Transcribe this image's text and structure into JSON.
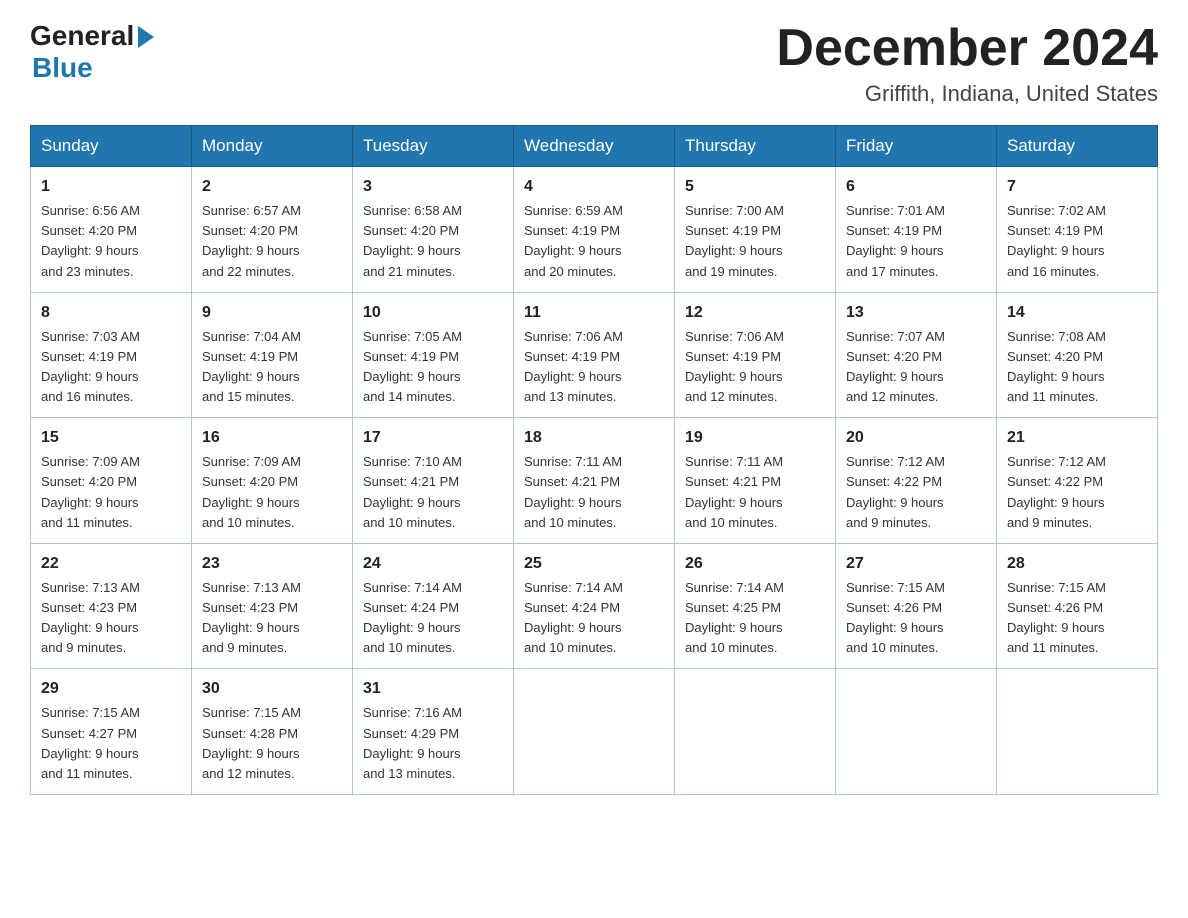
{
  "logo": {
    "line1": "General",
    "arrow": "▶",
    "line2": "Blue"
  },
  "header": {
    "month_title": "December 2024",
    "location": "Griffith, Indiana, United States"
  },
  "weekdays": [
    "Sunday",
    "Monday",
    "Tuesday",
    "Wednesday",
    "Thursday",
    "Friday",
    "Saturday"
  ],
  "weeks": [
    [
      {
        "day": "1",
        "sunrise": "6:56 AM",
        "sunset": "4:20 PM",
        "daylight": "9 hours and 23 minutes."
      },
      {
        "day": "2",
        "sunrise": "6:57 AM",
        "sunset": "4:20 PM",
        "daylight": "9 hours and 22 minutes."
      },
      {
        "day": "3",
        "sunrise": "6:58 AM",
        "sunset": "4:20 PM",
        "daylight": "9 hours and 21 minutes."
      },
      {
        "day": "4",
        "sunrise": "6:59 AM",
        "sunset": "4:19 PM",
        "daylight": "9 hours and 20 minutes."
      },
      {
        "day": "5",
        "sunrise": "7:00 AM",
        "sunset": "4:19 PM",
        "daylight": "9 hours and 19 minutes."
      },
      {
        "day": "6",
        "sunrise": "7:01 AM",
        "sunset": "4:19 PM",
        "daylight": "9 hours and 17 minutes."
      },
      {
        "day": "7",
        "sunrise": "7:02 AM",
        "sunset": "4:19 PM",
        "daylight": "9 hours and 16 minutes."
      }
    ],
    [
      {
        "day": "8",
        "sunrise": "7:03 AM",
        "sunset": "4:19 PM",
        "daylight": "9 hours and 16 minutes."
      },
      {
        "day": "9",
        "sunrise": "7:04 AM",
        "sunset": "4:19 PM",
        "daylight": "9 hours and 15 minutes."
      },
      {
        "day": "10",
        "sunrise": "7:05 AM",
        "sunset": "4:19 PM",
        "daylight": "9 hours and 14 minutes."
      },
      {
        "day": "11",
        "sunrise": "7:06 AM",
        "sunset": "4:19 PM",
        "daylight": "9 hours and 13 minutes."
      },
      {
        "day": "12",
        "sunrise": "7:06 AM",
        "sunset": "4:19 PM",
        "daylight": "9 hours and 12 minutes."
      },
      {
        "day": "13",
        "sunrise": "7:07 AM",
        "sunset": "4:20 PM",
        "daylight": "9 hours and 12 minutes."
      },
      {
        "day": "14",
        "sunrise": "7:08 AM",
        "sunset": "4:20 PM",
        "daylight": "9 hours and 11 minutes."
      }
    ],
    [
      {
        "day": "15",
        "sunrise": "7:09 AM",
        "sunset": "4:20 PM",
        "daylight": "9 hours and 11 minutes."
      },
      {
        "day": "16",
        "sunrise": "7:09 AM",
        "sunset": "4:20 PM",
        "daylight": "9 hours and 10 minutes."
      },
      {
        "day": "17",
        "sunrise": "7:10 AM",
        "sunset": "4:21 PM",
        "daylight": "9 hours and 10 minutes."
      },
      {
        "day": "18",
        "sunrise": "7:11 AM",
        "sunset": "4:21 PM",
        "daylight": "9 hours and 10 minutes."
      },
      {
        "day": "19",
        "sunrise": "7:11 AM",
        "sunset": "4:21 PM",
        "daylight": "9 hours and 10 minutes."
      },
      {
        "day": "20",
        "sunrise": "7:12 AM",
        "sunset": "4:22 PM",
        "daylight": "9 hours and 9 minutes."
      },
      {
        "day": "21",
        "sunrise": "7:12 AM",
        "sunset": "4:22 PM",
        "daylight": "9 hours and 9 minutes."
      }
    ],
    [
      {
        "day": "22",
        "sunrise": "7:13 AM",
        "sunset": "4:23 PM",
        "daylight": "9 hours and 9 minutes."
      },
      {
        "day": "23",
        "sunrise": "7:13 AM",
        "sunset": "4:23 PM",
        "daylight": "9 hours and 9 minutes."
      },
      {
        "day": "24",
        "sunrise": "7:14 AM",
        "sunset": "4:24 PM",
        "daylight": "9 hours and 10 minutes."
      },
      {
        "day": "25",
        "sunrise": "7:14 AM",
        "sunset": "4:24 PM",
        "daylight": "9 hours and 10 minutes."
      },
      {
        "day": "26",
        "sunrise": "7:14 AM",
        "sunset": "4:25 PM",
        "daylight": "9 hours and 10 minutes."
      },
      {
        "day": "27",
        "sunrise": "7:15 AM",
        "sunset": "4:26 PM",
        "daylight": "9 hours and 10 minutes."
      },
      {
        "day": "28",
        "sunrise": "7:15 AM",
        "sunset": "4:26 PM",
        "daylight": "9 hours and 11 minutes."
      }
    ],
    [
      {
        "day": "29",
        "sunrise": "7:15 AM",
        "sunset": "4:27 PM",
        "daylight": "9 hours and 11 minutes."
      },
      {
        "day": "30",
        "sunrise": "7:15 AM",
        "sunset": "4:28 PM",
        "daylight": "9 hours and 12 minutes."
      },
      {
        "day": "31",
        "sunrise": "7:16 AM",
        "sunset": "4:29 PM",
        "daylight": "9 hours and 13 minutes."
      },
      null,
      null,
      null,
      null
    ]
  ],
  "labels": {
    "sunrise": "Sunrise:",
    "sunset": "Sunset:",
    "daylight": "Daylight:"
  }
}
